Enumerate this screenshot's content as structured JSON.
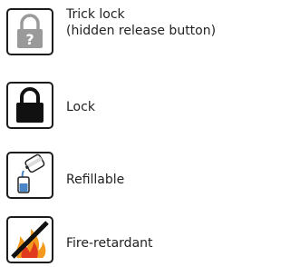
{
  "legend": {
    "items": [
      {
        "label_line1": "Trick lock",
        "label_line2": "(hidden release button)",
        "icon": "trick-lock-icon"
      },
      {
        "label": "Lock",
        "icon": "lock-icon"
      },
      {
        "label": "Refillable",
        "icon": "refill-icon"
      },
      {
        "label": "Fire-retardant",
        "icon": "fire-retardant-icon"
      }
    ]
  },
  "colors": {
    "trick_lock_fill": "#9a9a9a",
    "lock_fill": "#111111",
    "refill_liquid": "#4a86c5",
    "flame_orange": "#f39a1e",
    "flame_red": "#e03a1e",
    "prohibition_slash": "#111111"
  }
}
